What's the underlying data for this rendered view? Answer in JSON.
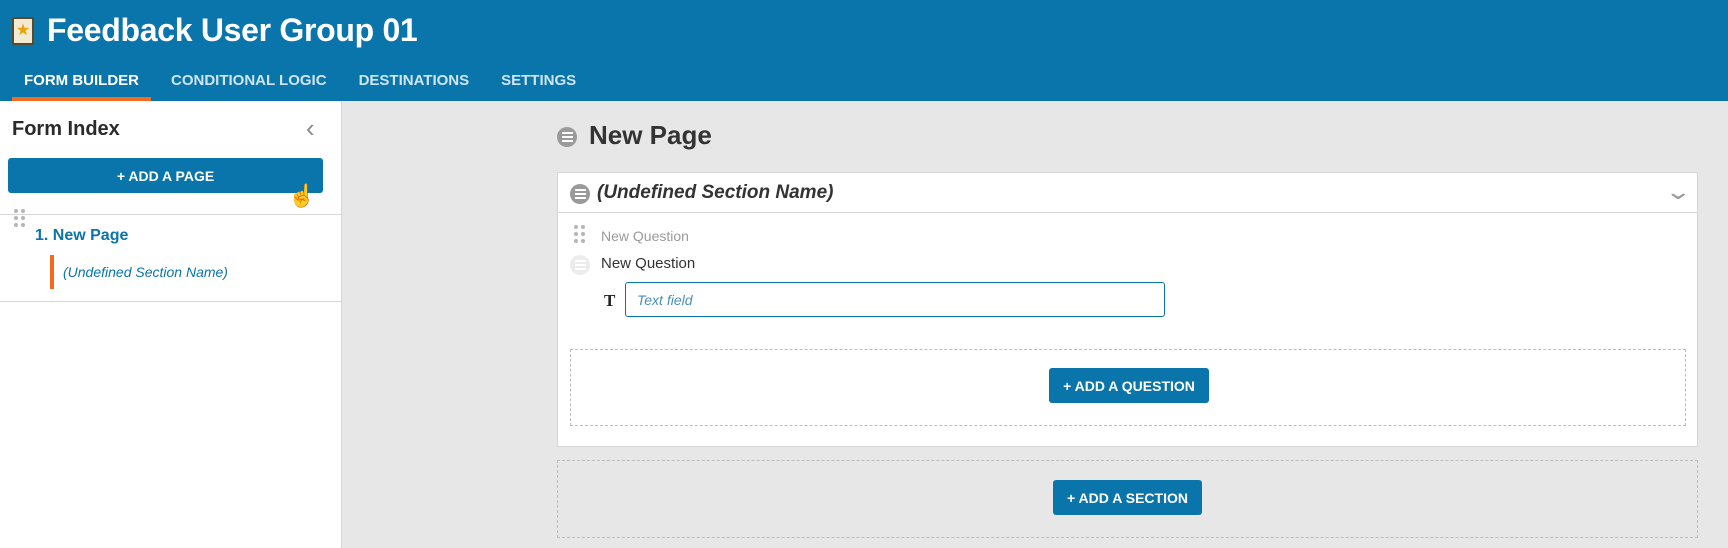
{
  "header": {
    "app_icon": "star-badge-icon",
    "title": "Feedback User Group 01",
    "tabs": [
      {
        "label": "FORM BUILDER",
        "active": true
      },
      {
        "label": "CONDITIONAL LOGIC",
        "active": false
      },
      {
        "label": "DESTINATIONS",
        "active": false
      },
      {
        "label": "SETTINGS",
        "active": false
      }
    ]
  },
  "sidebar": {
    "title": "Form Index",
    "collapse_icon": "chevron-left-icon",
    "add_page_label": "+ ADD A PAGE",
    "pages": [
      {
        "label": "1. New Page",
        "sections": [
          {
            "label": "(Undefined Section Name)"
          }
        ]
      }
    ]
  },
  "main": {
    "page_title": "New Page",
    "section": {
      "title": "(Undefined Section Name)",
      "question_ghost": "New Question",
      "question_label": "New Question",
      "field_type_icon": "text-type-icon",
      "field_placeholder": "Text field",
      "add_question_label": "+ ADD A QUESTION"
    },
    "add_section_label": "+ ADD A SECTION"
  },
  "colors": {
    "brand": "#0a75ab",
    "accent": "#f26b21",
    "background": "#e7e7e7"
  }
}
